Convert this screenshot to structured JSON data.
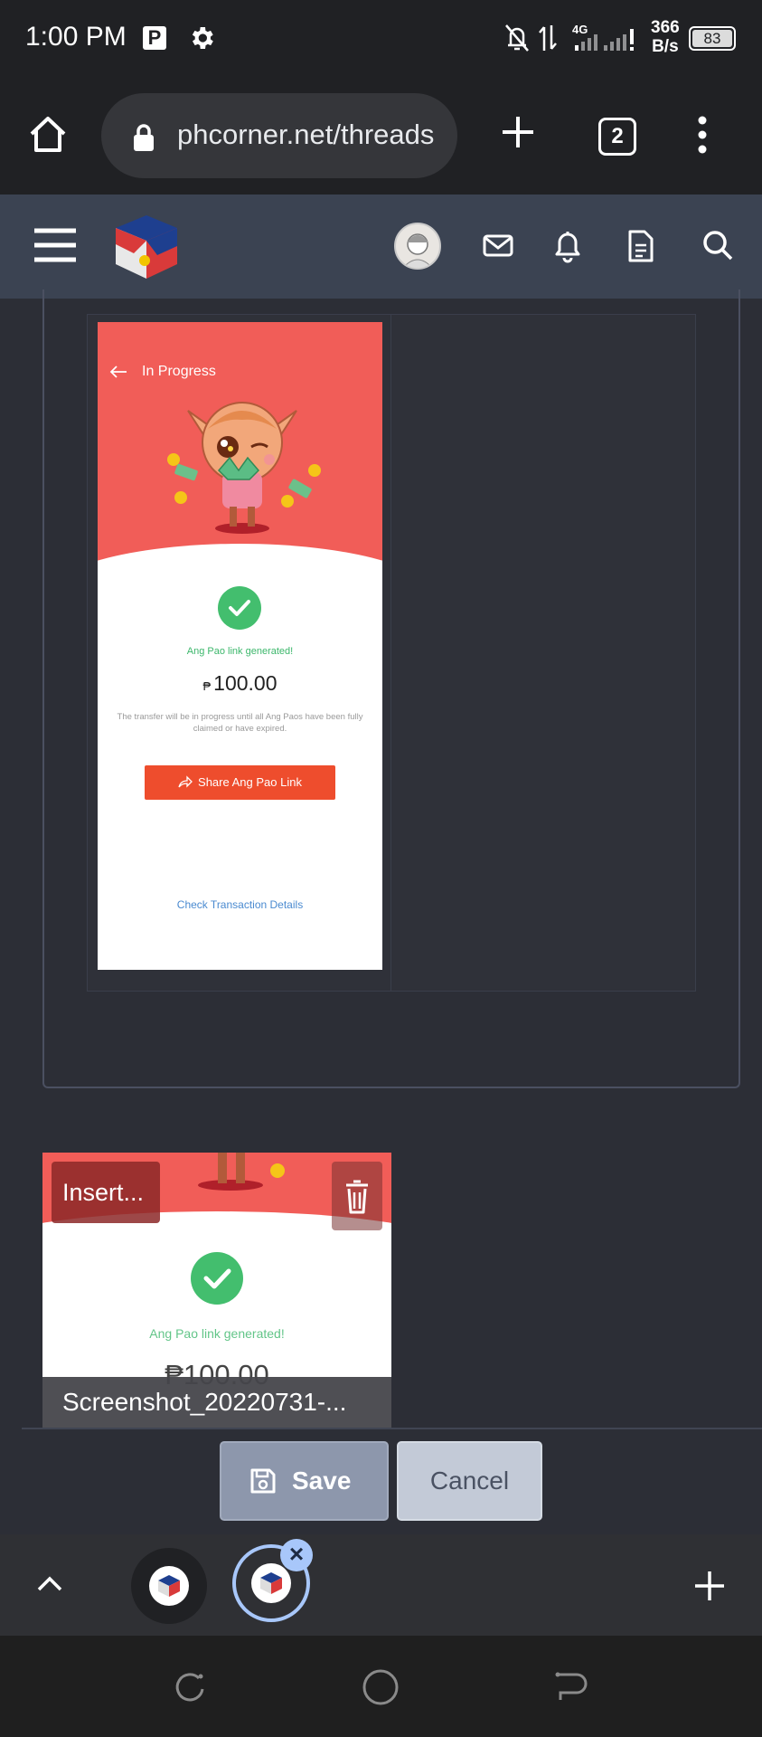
{
  "status_bar": {
    "time": "1:00 PM",
    "p_badge": "P",
    "network": "4G",
    "speed_value": "366",
    "speed_unit": "B/s",
    "battery": "83",
    "icons": [
      "settings-gear-icon",
      "notifications-off-icon",
      "data-transfer-icon",
      "signal-icon",
      "battery-icon"
    ]
  },
  "browser": {
    "url": "phcorner.net/threads",
    "tab_count": "2",
    "icons": [
      "home-icon",
      "lock-icon",
      "new-tab-icon",
      "menu-icon"
    ]
  },
  "site_header": {
    "icons": [
      "hamburger-menu-icon",
      "phcorner-logo",
      "avatar",
      "mail-icon",
      "bell-icon",
      "document-icon",
      "search-icon"
    ]
  },
  "post_image": {
    "title": "In Progress",
    "generated_text": "Ang Pao link generated!",
    "currency": "₱",
    "amount": "100.00",
    "note": "The transfer will be in progress until all Ang Paos have been fully claimed or have expired.",
    "share_button": "Share Ang Pao Link",
    "check_details": "Check Transaction Details"
  },
  "attachment": {
    "insert_label": "Insert...",
    "generated_text": "Ang Pao link generated!",
    "amount": "₱100.00",
    "filename": "Screenshot_20220731-..."
  },
  "form": {
    "save_label": "Save",
    "cancel_label": "Cancel"
  },
  "colors": {
    "accent_red": "#f15d58",
    "share_orange": "#ee4d2d",
    "success_green": "#43be6e",
    "header_bg": "#3b4352"
  }
}
